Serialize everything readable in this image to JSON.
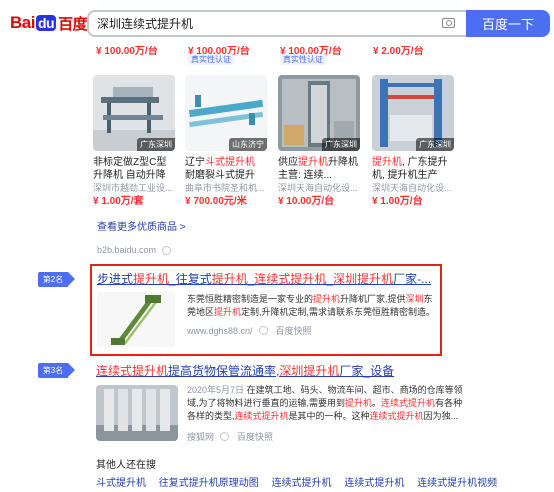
{
  "logo": {
    "bai": "Bai",
    "du": "du",
    "cn": "百度"
  },
  "search": {
    "query": "深圳连续式提升机",
    "button_label": "百度一下"
  },
  "top_partial": [
    {
      "price": "¥ 100.00万/台"
    },
    {
      "price": "¥ 100.00万/台",
      "badge": "真实性认证"
    },
    {
      "price": "¥ 100.00万/台",
      "badge": "真实性认证"
    },
    {
      "price": "¥ 2.00万/台"
    }
  ],
  "products": [
    {
      "title_pre": "非标定做Z型C型升降机 自动升降机...",
      "title_em": "",
      "title_post": "",
      "store": "深圳市越劲工业设...",
      "price": "¥ 1.00万/套",
      "location": "广东深圳"
    },
    {
      "title_pre": "辽宁",
      "title_em": "斗式提升机",
      "title_post": " 耐磨裂斗式提升机...",
      "store": "曲阜市书院圣和机...",
      "price": "¥ 700.00元/米",
      "location": "山东济宁"
    },
    {
      "title_pre": "供应",
      "title_em": "提升机",
      "title_post": "升降机主营: 连续...",
      "store": "深圳天海自动化设...",
      "price": "¥ 10.00万/台",
      "location": "广东深圳"
    },
    {
      "title_pre": "",
      "title_em": "提升机",
      "title_post": ", 广东提升机, 提升机生产厂...",
      "store": "深圳天海自动化设...",
      "price": "¥ 1.00万/台",
      "location": "广东深圳"
    }
  ],
  "more_link": "查看更多优质商品 >",
  "source_url": "b2b.baidu.com",
  "result2": {
    "rank": "第2名",
    "title": [
      {
        "t": "步进式",
        "e": false
      },
      {
        "t": "提升机",
        "e": true
      },
      {
        "t": "_往复式",
        "e": false
      },
      {
        "t": "提升机",
        "e": true
      },
      {
        "t": "_",
        "e": false
      },
      {
        "t": "连续式提升机",
        "e": true
      },
      {
        "t": "_",
        "e": false
      },
      {
        "t": "深圳",
        "e": true
      },
      {
        "t": "提升机",
        "e": true
      },
      {
        "t": "厂家-...",
        "e": false
      }
    ],
    "snippet": [
      {
        "t": "东莞恒胜精密制造是一家专业的",
        "e": false
      },
      {
        "t": "提升机",
        "e": true
      },
      {
        "t": "升降机厂家,提供",
        "e": false
      },
      {
        "t": "深圳",
        "e": true
      },
      {
        "t": "东莞地区",
        "e": false
      },
      {
        "t": "提升机",
        "e": true
      },
      {
        "t": "定制,升降机定制,需求请联系东莞恒胜精密制造。",
        "e": false
      }
    ],
    "url": "www.dghs88.cn/",
    "snapshot": "百度快照"
  },
  "result3": {
    "rank": "第3名",
    "title": [
      {
        "t": "连续式提升机",
        "e": true
      },
      {
        "t": "提高货物保管流通率,",
        "e": false
      },
      {
        "t": "深圳",
        "e": true
      },
      {
        "t": "提升机",
        "e": true
      },
      {
        "t": "厂家_设备",
        "e": false
      }
    ],
    "date": "2020年5月7日",
    "snippet": [
      {
        "t": "在建筑工地、码头、物流车间、超市、商场的仓库等领域,为了将物料进行垂直的运输,需要用到",
        "e": false
      },
      {
        "t": "提升机",
        "e": true
      },
      {
        "t": "。",
        "e": false
      },
      {
        "t": "连续式提升机",
        "e": true
      },
      {
        "t": "有各种各样的类型,",
        "e": false
      },
      {
        "t": "连续式提升机",
        "e": true
      },
      {
        "t": "是其中的一种。这种",
        "e": false
      },
      {
        "t": "连续式提升机",
        "e": true
      },
      {
        "t": "因为独...",
        "e": false
      }
    ],
    "source": "搜狐网",
    "snapshot": "百度快照"
  },
  "related": {
    "title": "其他人还在搜",
    "links": [
      "斗式提升机",
      "往复式提升机原理动图",
      "连续式提升机",
      "连续式提升机",
      "连续式提升机视频"
    ]
  },
  "colors": {
    "brand_blue": "#4e6ef2",
    "link": "#2440b3",
    "highlight": "#f73131",
    "frame": "#e1251b"
  }
}
